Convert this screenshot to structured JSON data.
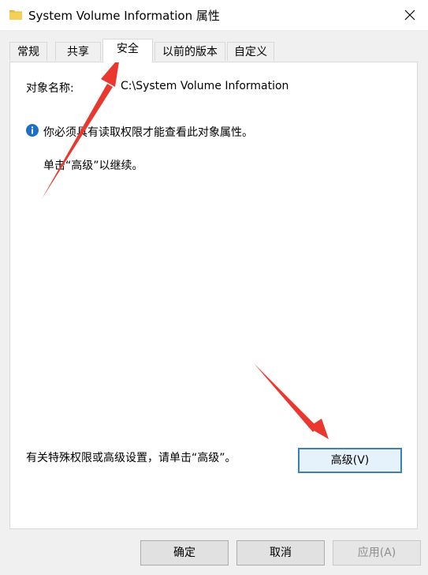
{
  "window": {
    "title": "System Volume Information 属性",
    "icon": "folder-icon"
  },
  "tabs": [
    {
      "label": "常规",
      "active": false
    },
    {
      "label": "共享",
      "active": false
    },
    {
      "label": "安全",
      "active": true
    },
    {
      "label": "以前的版本",
      "active": false
    },
    {
      "label": "自定义",
      "active": false
    }
  ],
  "security": {
    "object_name_label": "对象名称:",
    "object_name_value": "C:\\System Volume Information",
    "info_message": "你必须具有读取权限才能查看此对象属性。",
    "hint_message": "单击“高级”以继续。",
    "special_permissions_text": "有关特殊权限或高级设置，请单击“高级”。",
    "advanced_button_label": "高级(V)"
  },
  "footer": {
    "ok_label": "确定",
    "cancel_label": "取消",
    "apply_label": "应用(A)"
  },
  "colors": {
    "annotation_arrow": "#e8382f",
    "info_icon": "#1e6fc6",
    "advanced_button_border": "#3c7fb1"
  }
}
